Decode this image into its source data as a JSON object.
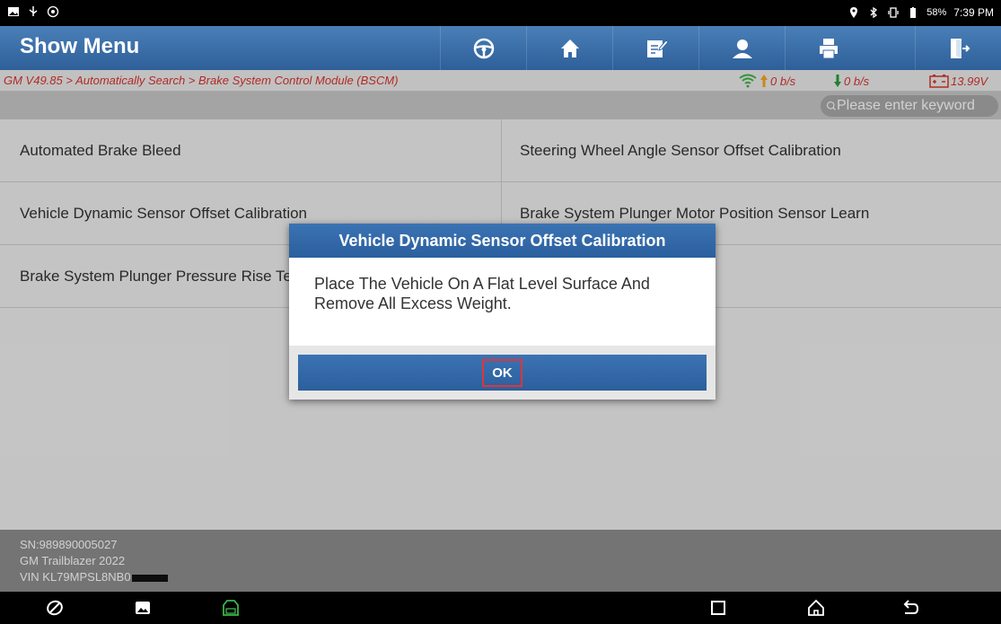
{
  "status_bar": {
    "battery": "58%",
    "time": "7:39 PM"
  },
  "header": {
    "title": "Show Menu",
    "toolbar_icons": [
      "steering-wheel-icon",
      "home-icon",
      "edit-icon",
      "user-icon",
      "print-icon",
      "exit-icon"
    ]
  },
  "breadcrumb": {
    "path": "GM V49.85 > Automatically Search > Brake System Control Module (BSCM)",
    "upload": "0 b/s",
    "download": "0 b/s",
    "voltage": "13.99V"
  },
  "search": {
    "placeholder": "Please enter keyword"
  },
  "menu": {
    "items": [
      "Automated Brake Bleed",
      "Steering Wheel Angle Sensor Offset Calibration",
      "Vehicle Dynamic Sensor Offset Calibration",
      "Brake System Plunger Motor Position Sensor Learn",
      "Brake System Plunger Pressure Rise Test"
    ]
  },
  "info": {
    "sn": "SN:989890005027",
    "vehicle": "GM Trailblazer 2022",
    "vin": "VIN KL79MPSL8NB0"
  },
  "dialog": {
    "title": "Vehicle Dynamic Sensor Offset Calibration",
    "message": "Place The Vehicle On A Flat Level Surface And Remove All Excess Weight.",
    "ok_label": "OK"
  },
  "colors": {
    "header_blue": "#2e5f99",
    "breadcrumb_red": "#d9342b",
    "ok_highlight": "#e0353a"
  }
}
